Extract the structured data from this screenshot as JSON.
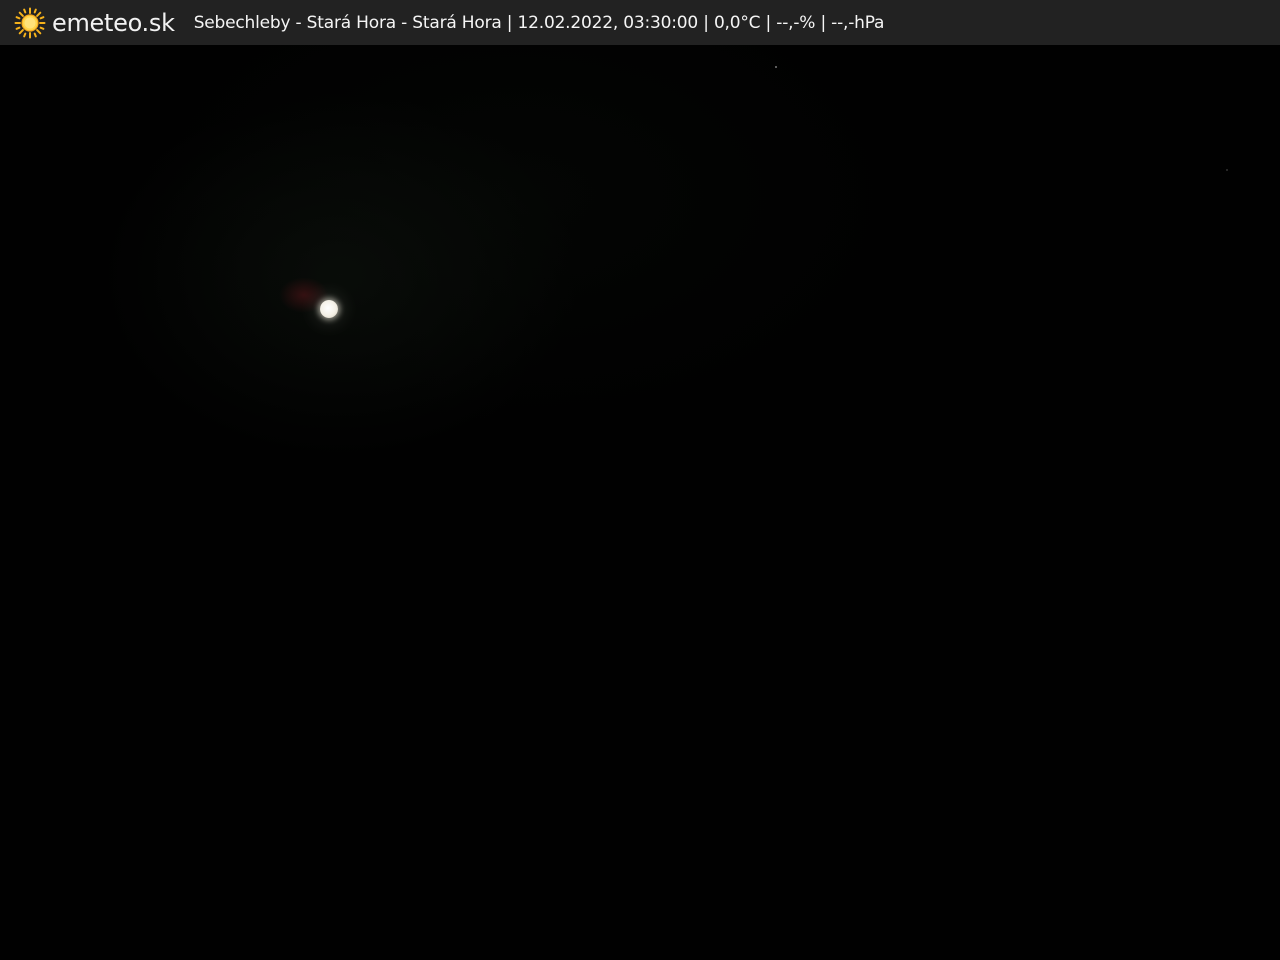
{
  "header": {
    "brand": "emeteo.sk",
    "caption": "Sebechleby - Stará Hora - Stará Hora | 12.02.2022, 03:30:00 | 0,0°C | --,-% | --,-hPa",
    "logo_icon": "sun-icon",
    "logo_color": "#f6b21b"
  },
  "webcam": {
    "scene": "night-sky",
    "background_color": "#010101",
    "moon_color": "#f4f0e6"
  }
}
